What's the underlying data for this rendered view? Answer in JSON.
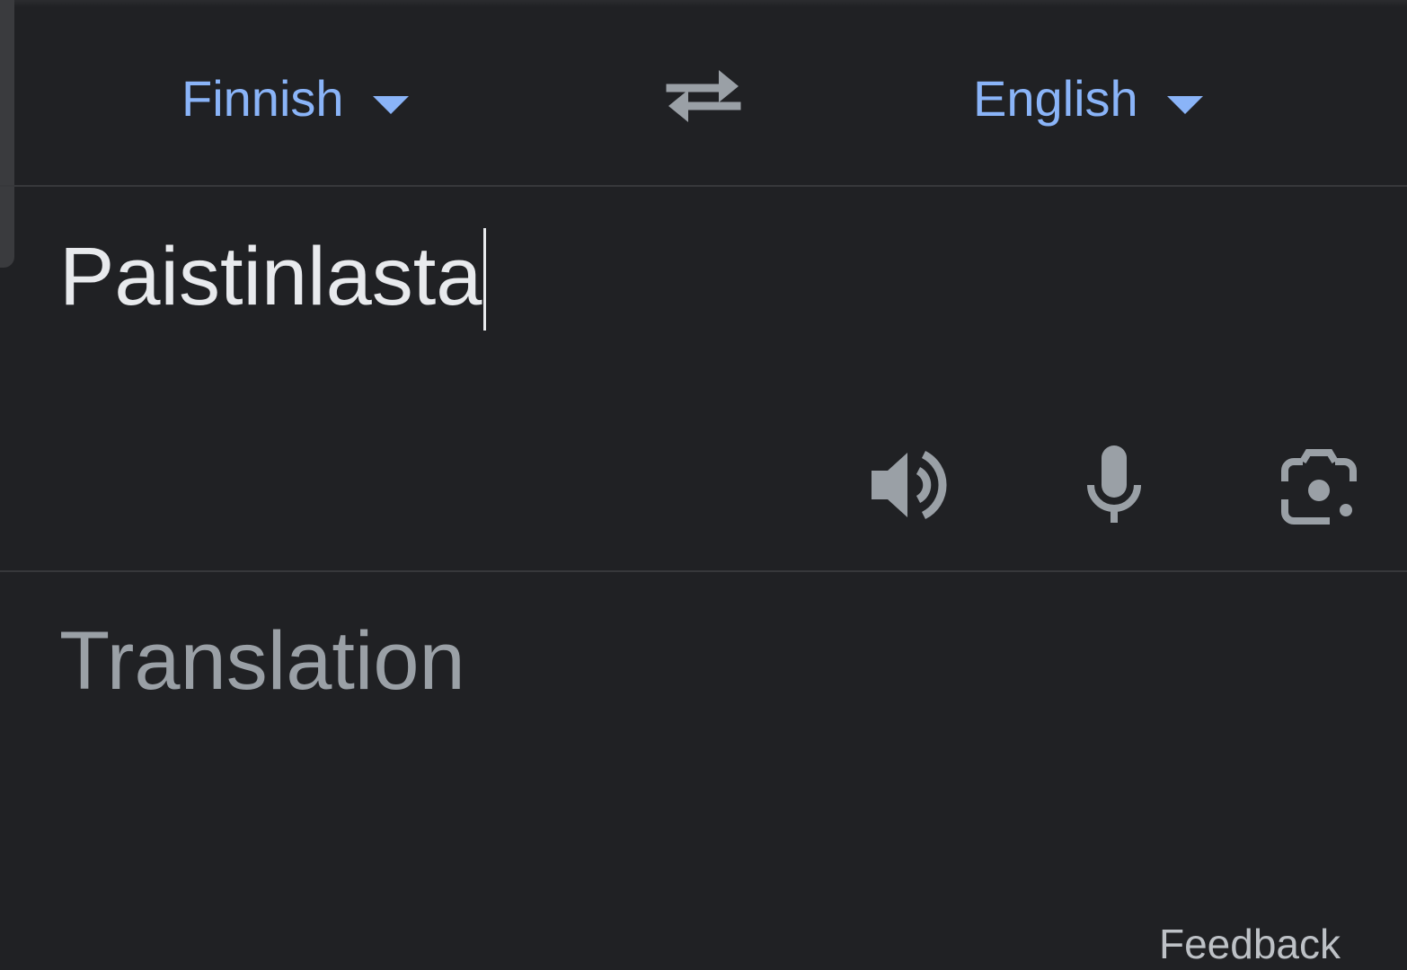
{
  "language_bar": {
    "source_language": "Finnish",
    "target_language": "English",
    "swap_icon": "swap-horiz-icon",
    "dropdown_icon": "arrow-drop-down-icon"
  },
  "input": {
    "text": "Paistinlasta",
    "tools": {
      "speaker_icon": "volume-up-icon",
      "mic_icon": "mic-icon",
      "camera_icon": "camera-search-icon"
    }
  },
  "output": {
    "placeholder": "Translation"
  },
  "footer": {
    "feedback_label": "Feedback"
  },
  "colors": {
    "background": "#202124",
    "accent": "#8ab4f8",
    "text_primary": "#e8eaed",
    "text_secondary": "#9aa0a6",
    "icon": "#9aa0a6",
    "divider": "#37383b"
  }
}
